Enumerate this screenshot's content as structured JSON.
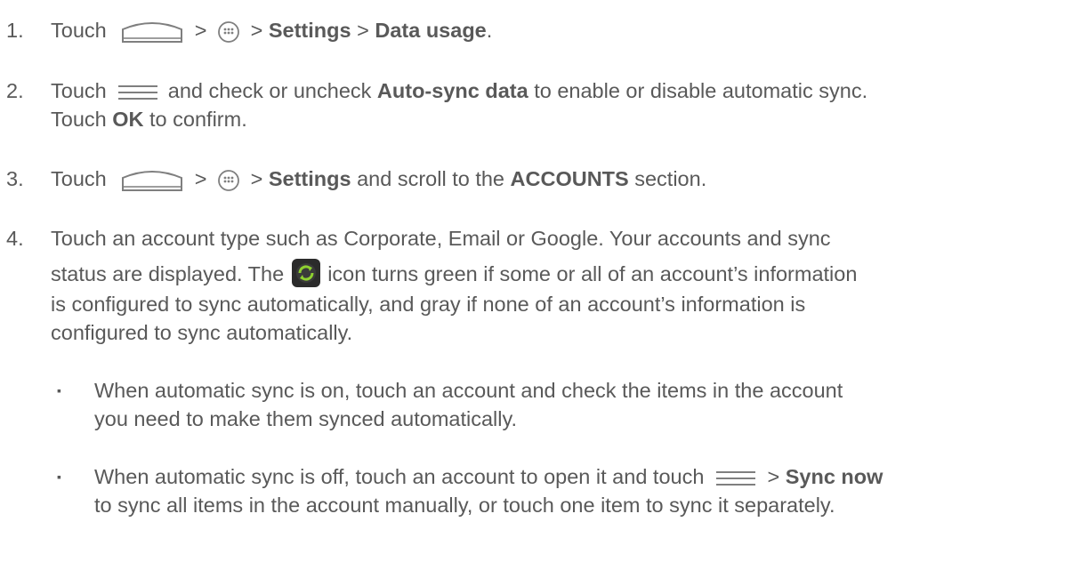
{
  "steps": [
    {
      "num": "1.",
      "t1": "Touch",
      "sep1": ">",
      "sep2": ">",
      "b1": "Settings",
      "sep3": ">",
      "b2": "Data usage",
      "end": "."
    },
    {
      "num": "2.",
      "t1": "Touch",
      "t2": "and check or uncheck",
      "b1": "Auto-sync data",
      "t3": "to enable or disable automatic sync.",
      "t4": "Touch",
      "b2": "OK",
      "t5": "to confirm."
    },
    {
      "num": "3.",
      "t1": "Touch",
      "sep1": ">",
      "sep2": ">",
      "b1": "Settings",
      "t2": "and scroll to the",
      "b2": "ACCOUNTS",
      "t3": "section."
    },
    {
      "num": "4.",
      "l1": "Touch an account type such as Corporate, Email or Google. Your accounts and sync",
      "l2a": "status are displayed. The",
      "l2b": "icon turns green if some or all of an account’s information",
      "l3": "is configured to sync automatically, and gray if none of an account’s information is",
      "l4": "configured to sync automatically."
    }
  ],
  "bullets": [
    {
      "mark": "▪",
      "l1": "When automatic sync is on, touch an account and check the items in the account",
      "l2": "you need to make them synced automatically."
    },
    {
      "mark": "▪",
      "l1": "When automatic sync is off, touch an account to open it and touch",
      "sep": ">",
      "b": "Sync now",
      "l2": "to sync all items in the account manually, or touch one item to sync it separately."
    }
  ],
  "icons": [
    "home-icon",
    "apps-icon",
    "menu-icon",
    "sync-icon"
  ]
}
